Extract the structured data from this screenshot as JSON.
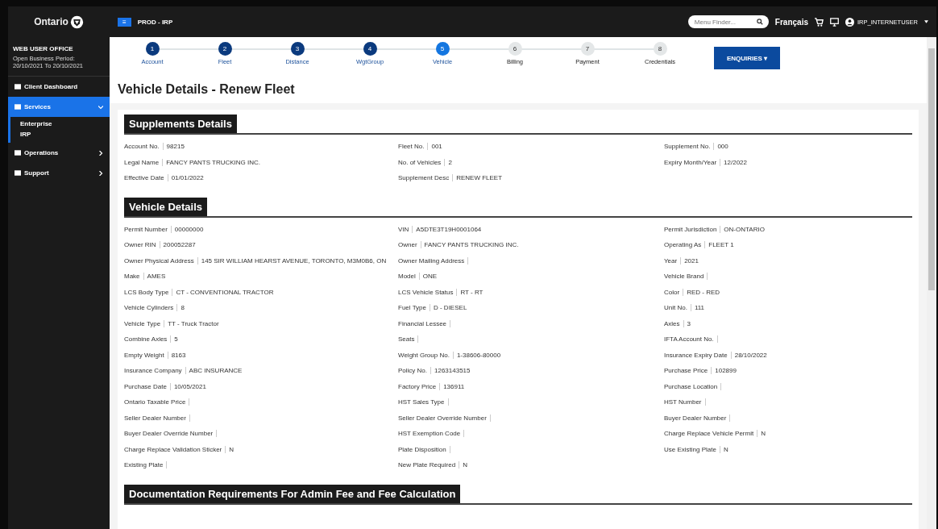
{
  "top_bar": {
    "menu_badge": "≡",
    "environment": "PROD - IRP",
    "search": {
      "placeholder": "Menu Finder..."
    },
    "language": "Français",
    "user": "IRP_INTERNETUSER"
  },
  "sidebar": {
    "logo": "Ontario",
    "office": "WEB USER OFFICE",
    "period_label": "Open Business Period:",
    "period": "20/10/2021 To 20/10/2021",
    "items": [
      {
        "label": "Client Dashboard",
        "selected": false
      },
      {
        "label": "Services",
        "selected": true,
        "expanded": true,
        "children": [
          {
            "label": "Enterprise"
          },
          {
            "label": "IRP"
          }
        ]
      },
      {
        "label": "Operations",
        "selected": false,
        "expanded": false
      },
      {
        "label": "Support",
        "selected": false,
        "expanded": false
      }
    ]
  },
  "steps": [
    {
      "number": "1",
      "label": "Account",
      "completed": true,
      "selected": false
    },
    {
      "number": "2",
      "label": "Fleet",
      "completed": true,
      "selected": false
    },
    {
      "number": "3",
      "label": "Distance",
      "completed": true,
      "selected": false
    },
    {
      "number": "4",
      "label": "WgtGroup",
      "completed": true,
      "selected": false
    },
    {
      "number": "5",
      "label": "Vehicle",
      "completed": false,
      "selected": true
    },
    {
      "number": "6",
      "label": "Billing",
      "completed": false,
      "selected": false
    },
    {
      "number": "7",
      "label": "Payment",
      "completed": false,
      "selected": false
    },
    {
      "number": "8",
      "label": "Credentials",
      "completed": false,
      "selected": false
    }
  ],
  "enquiries_button": "ENQUIRIES ▾",
  "page_title": "Vehicle Details - Renew Fleet",
  "sections": [
    {
      "title": "Supplements Details",
      "fields": [
        {
          "label": "Account No.",
          "value": "98215"
        },
        {
          "label": "Fleet No.",
          "value": "001"
        },
        {
          "label": "Supplement No.",
          "value": "000"
        },
        {
          "label": "Legal Name",
          "value": "FANCY PANTS TRUCKING INC."
        },
        {
          "label": "No. of Vehicles",
          "value": "2"
        },
        {
          "label": "Expiry Month/Year",
          "value": "12/2022"
        },
        {
          "label": "Effective Date",
          "value": "01/01/2022"
        },
        {
          "label": "Supplement Desc",
          "value": "RENEW FLEET"
        }
      ]
    },
    {
      "title": "Vehicle Details",
      "fields": [
        {
          "label": "Permit Number",
          "value": "00000000"
        },
        {
          "label": "VIN",
          "value": "A5DTE3T19H0001064"
        },
        {
          "label": "Permit Jurisdiction",
          "value": "ON-ONTARIO"
        },
        {
          "label": "Owner RIN",
          "value": "200052287"
        },
        {
          "label": "Owner",
          "value": "FANCY PANTS TRUCKING INC."
        },
        {
          "label": "Operating As",
          "value": "FLEET 1"
        },
        {
          "label": "Owner Physical Address",
          "value": "145 SIR WILLIAM HEARST AVENUE, TORONTO, M3M0B6, ON"
        },
        {
          "label": "Owner Mailing Address"
        },
        {
          "label": "Year",
          "value": "2021"
        },
        {
          "label": "Make",
          "value": "AMES"
        },
        {
          "label": "Model",
          "value": "ONE"
        },
        {
          "label": "Vehicle Brand"
        },
        {
          "label": "LCS Body Type",
          "value": "CT - CONVENTIONAL TRACTOR"
        },
        {
          "label": "LCS Vehicle Status",
          "value": "RT - RT"
        },
        {
          "label": "Color",
          "value": "RED - RED"
        },
        {
          "label": "Vehicle Cylinders",
          "value": "8"
        },
        {
          "label": "Fuel Type",
          "value": "D - DIESEL"
        },
        {
          "label": "Unit No.",
          "value": "111"
        },
        {
          "label": "Vehicle Type",
          "value": "TT - Truck Tractor"
        },
        {
          "label": "Financial Lessee"
        },
        {
          "label": "Axles",
          "value": "3"
        },
        {
          "label": "Combine Axles",
          "value": "5"
        },
        {
          "label": "Seats"
        },
        {
          "label": "IFTA Account No."
        },
        {
          "label": "Empty Weight",
          "value": "8163"
        },
        {
          "label": "Weight Group No.",
          "value": "1-38606-80000"
        },
        {
          "label": "Insurance Expiry Date",
          "value": "28/10/2022"
        },
        {
          "label": "Insurance Company",
          "value": "ABC INSURANCE"
        },
        {
          "label": "Policy No.",
          "value": "1263143515"
        },
        {
          "label": "Purchase Price",
          "value": "102899"
        },
        {
          "label": "Purchase Date",
          "value": "10/05/2021"
        },
        {
          "label": "Factory Price",
          "value": "136911"
        },
        {
          "label": "Purchase Location"
        },
        {
          "label": "Ontario Taxable Price"
        },
        {
          "label": "HST Sales Type"
        },
        {
          "label": "HST Number"
        },
        {
          "label": "Seller Dealer Number"
        },
        {
          "label": "Seller Dealer Override Number"
        },
        {
          "label": "Buyer Dealer Number"
        },
        {
          "label": "Buyer Dealer Override Number"
        },
        {
          "label": "HST Exemption Code"
        },
        {
          "label": "Charge Replace Vehicle Permit",
          "value": "N"
        },
        {
          "label": "Charge Replace Validation Sticker",
          "value": "N"
        },
        {
          "label": "Plate Disposition"
        },
        {
          "label": "Use Existing Plate",
          "value": "N"
        },
        {
          "label": "Existing Plate"
        },
        {
          "label": "New Plate Required",
          "value": "N"
        }
      ]
    },
    {
      "title": "Documentation Requirements For Admin Fee and Fee Calculation"
    }
  ]
}
